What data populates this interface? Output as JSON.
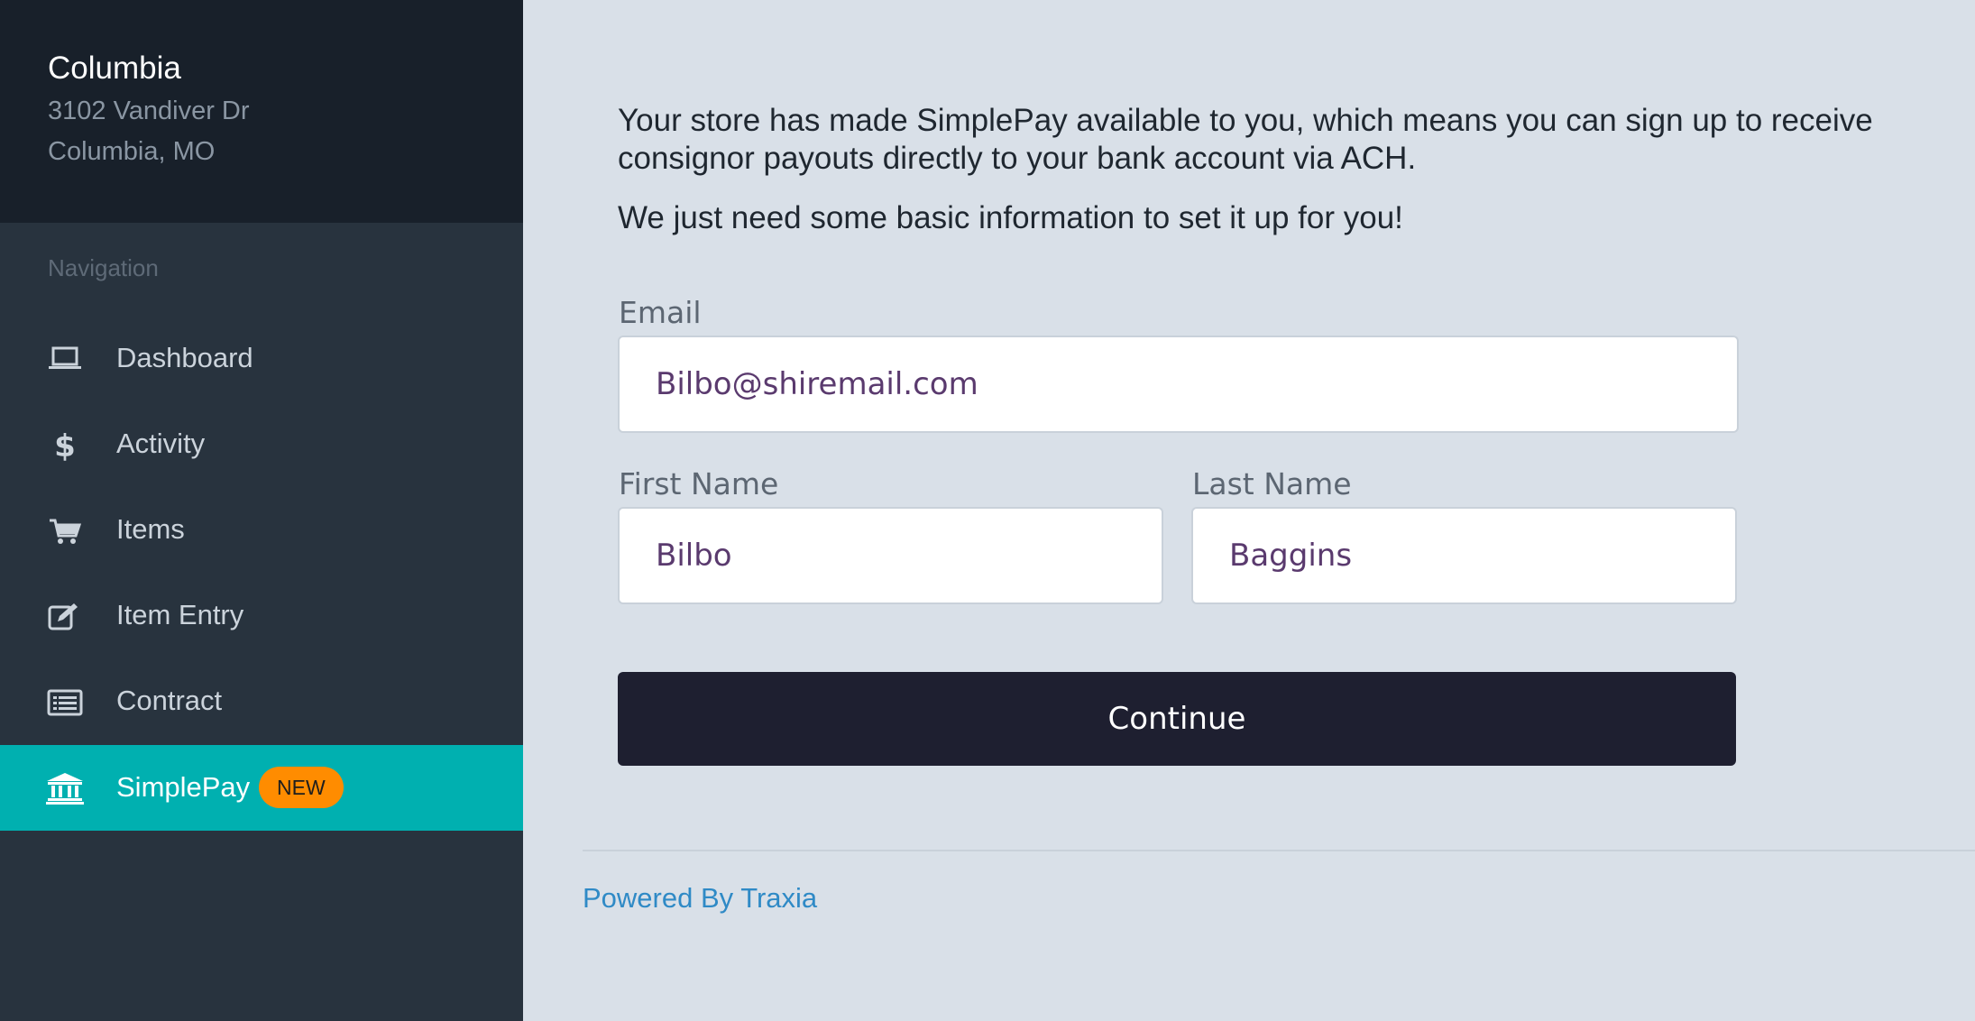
{
  "store": {
    "name": "Columbia",
    "address_line1": "3102 Vandiver Dr",
    "address_line2": "Columbia, MO"
  },
  "sidebar": {
    "heading": "Navigation",
    "items": [
      {
        "label": "Dashboard",
        "icon": "laptop-icon"
      },
      {
        "label": "Activity",
        "icon": "dollar-icon"
      },
      {
        "label": "Items",
        "icon": "cart-icon"
      },
      {
        "label": "Item Entry",
        "icon": "edit-icon"
      },
      {
        "label": "Contract",
        "icon": "list-icon"
      },
      {
        "label": "SimplePay",
        "icon": "bank-icon",
        "badge": "NEW",
        "active": true
      }
    ]
  },
  "main": {
    "intro": "Your store has made SimplePay available to you, which means you can sign up to receive consignor payouts directly to your bank account via ACH.",
    "intro2": "We just need some basic information to set it up for you!",
    "form": {
      "email_label": "Email",
      "email_value": "Bilbo@shiremail.com",
      "first_name_label": "First Name",
      "first_name_value": "Bilbo",
      "last_name_label": "Last Name",
      "last_name_value": "Baggins",
      "continue_label": "Continue"
    },
    "footer": {
      "powered_by": "Powered By Traxia"
    }
  },
  "colors": {
    "sidebar_bg": "#28333e",
    "header_bg": "#18202a",
    "active_bg": "#00b0b0",
    "badge_bg": "#ff8c00",
    "button_bg": "#1e1f30",
    "link": "#2f8ac6"
  }
}
